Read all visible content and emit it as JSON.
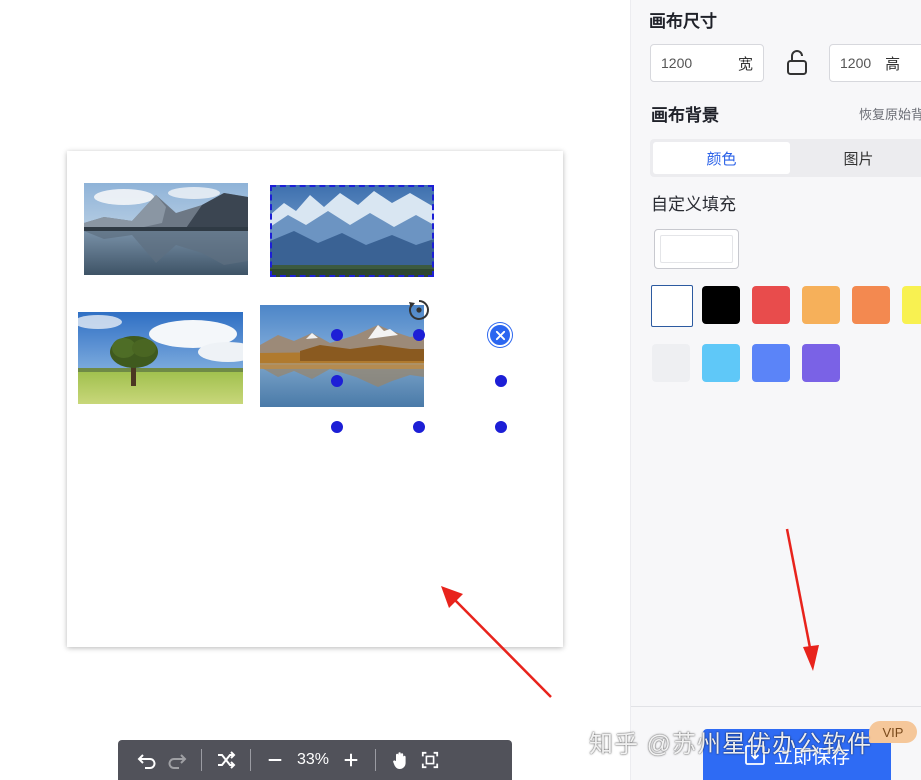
{
  "toolbar": {
    "zoom": "33%",
    "icons": [
      "undo-icon",
      "redo-icon",
      "shuffle-icon",
      "zoom-out-icon",
      "zoom-in-icon",
      "hand-icon",
      "fit-screen-icon"
    ]
  },
  "panel": {
    "canvas_size": {
      "title": "画布尺寸",
      "width_value": "1200",
      "width_unit": "宽",
      "height_value": "1200",
      "height_unit": "高"
    },
    "canvas_bg": {
      "title": "画布背景",
      "restore_label": "恢复原始背景",
      "tabs": [
        {
          "label": "颜色",
          "active": true
        },
        {
          "label": "图片",
          "active": false
        }
      ],
      "custom_fill_label": "自定义填充",
      "custom_fill_color": "#ffffff",
      "swatches": [
        "#ffffff",
        "#000000",
        "#e84c4c",
        "#f6b05a",
        "#f38950",
        "#f8f151",
        "#eeeff2",
        "#5fc8f8",
        "#5b84f8",
        "#7a62e6"
      ]
    },
    "save_label": "立即保存",
    "vip_label": "VIP"
  },
  "colors": {
    "accent": "#2e6bf4",
    "selection": "#1d1fd6",
    "arrow": "#e8231c"
  },
  "watermark": "知乎 @苏州星优办公软件"
}
